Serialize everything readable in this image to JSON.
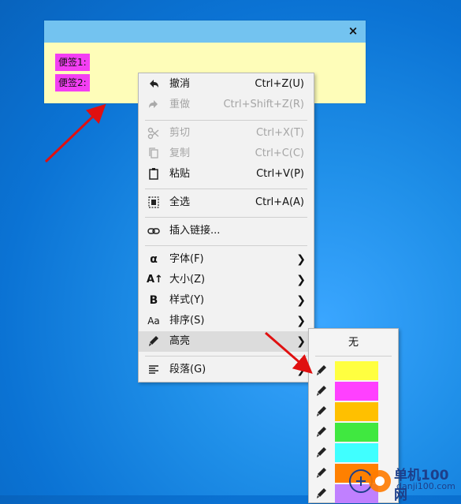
{
  "note": {
    "close": "×",
    "lines": [
      "便签1:",
      "便签2:"
    ]
  },
  "menu": {
    "items": [
      {
        "label": "撤消",
        "shortcut": "Ctrl+Z(U)",
        "icon": "undo-icon"
      },
      {
        "label": "重做",
        "shortcut": "Ctrl+Shift+Z(R)",
        "icon": "redo-icon"
      },
      {
        "label": "剪切",
        "shortcut": "Ctrl+X(T)",
        "icon": "scissors-icon"
      },
      {
        "label": "复制",
        "shortcut": "Ctrl+C(C)",
        "icon": "copy-icon"
      },
      {
        "label": "粘贴",
        "shortcut": "Ctrl+V(P)",
        "icon": "clipboard-icon"
      },
      {
        "label": "全选",
        "shortcut": "Ctrl+A(A)",
        "icon": "select-all-icon"
      },
      {
        "label": "插入链接...",
        "icon": "link-icon"
      },
      {
        "label": "字体(F)",
        "icon": "alpha-icon",
        "glyph": "α"
      },
      {
        "label": "大小(Z)",
        "icon": "font-size-icon",
        "glyph": "A↑"
      },
      {
        "label": "样式(Y)",
        "icon": "bold-icon",
        "glyph": "B"
      },
      {
        "label": "排序(S)",
        "icon": "case-icon",
        "glyph": "Aa"
      },
      {
        "label": "高亮",
        "icon": "highlighter-icon"
      },
      {
        "label": "段落(G)",
        "icon": "paragraph-icon"
      }
    ],
    "arrow": "❯"
  },
  "submenu": {
    "none_label": "无",
    "colors": [
      "#ffff40",
      "#ff40ff",
      "#ffc000",
      "#40e840",
      "#40ffff",
      "#ff8000",
      "#c080ff"
    ]
  },
  "watermark": {
    "text1": "单机100网",
    "text2": "danji100.com"
  },
  "colors": {
    "note_bg": "#fefdb9",
    "note_titlebar": "#73c3f0",
    "note_highlight": "#f33ff3",
    "arrow": "#e01010"
  }
}
